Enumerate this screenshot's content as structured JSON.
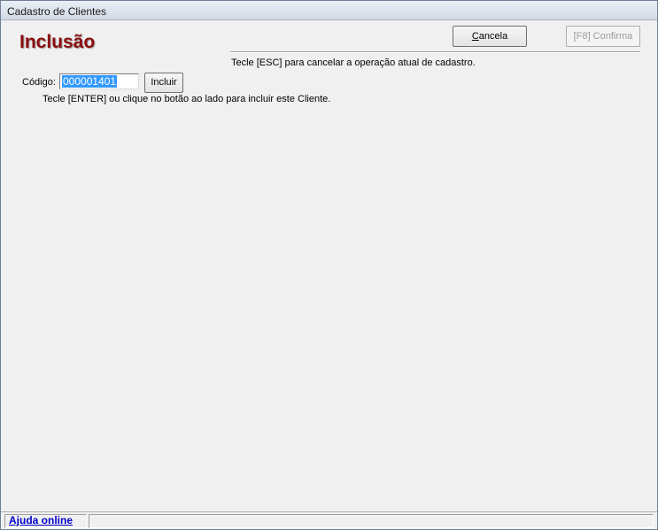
{
  "window": {
    "title": "Cadastro de Clientes"
  },
  "header": {
    "mode_title": "Inclusão"
  },
  "actions": {
    "cancel_prefix": "",
    "cancel_mnemonic": "C",
    "cancel_suffix": "ancela",
    "confirm_label": "[F8]   Confirma",
    "confirm_enabled": false
  },
  "hints": {
    "esc": "Tecle [ESC] para cancelar a operação atual de cadastro.",
    "enter": "Tecle [ENTER] ou clique no botão ao lado para incluir este Cliente."
  },
  "form": {
    "code_label": "Código:",
    "code_value": "000001401",
    "include_label": "Incluir"
  },
  "statusbar": {
    "help_link": "Ajuda online"
  },
  "colors": {
    "mode_title": "#8b0d0d",
    "selection": "#3399ff",
    "link": "#0000cc"
  }
}
